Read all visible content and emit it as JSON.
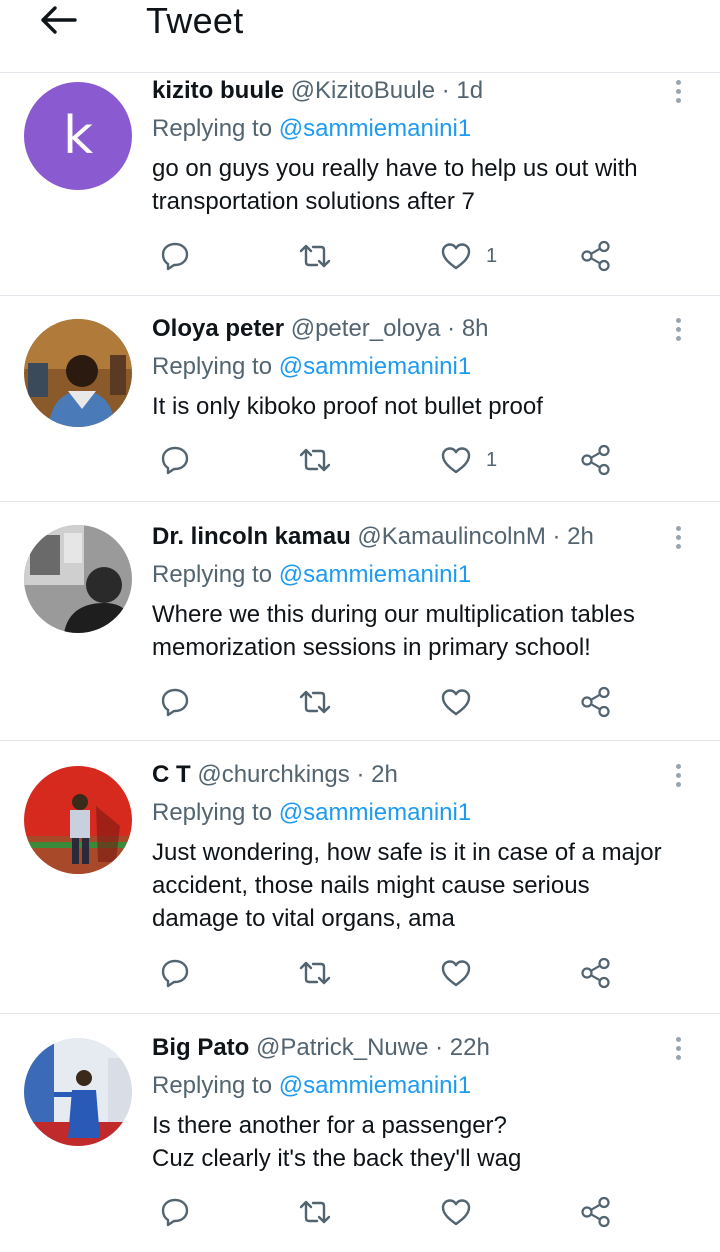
{
  "header": {
    "title": "Tweet",
    "back_icon": "arrow-left-icon"
  },
  "replying_label": "Replying to",
  "tweets": [
    {
      "name": "kizito buule",
      "meta": "@KizitoBuule · 1d",
      "avatar_letter": "k",
      "avatar_color": "#8a5ad0",
      "reply_to": "@sammiemanini1",
      "text": "go on guys you really have to help us out with transportation solutions after 7",
      "likes": "1"
    },
    {
      "name": "Oloya peter",
      "meta": "@peter_oloya · 8h",
      "reply_to": "@sammiemanini1",
      "text": "It is only kiboko proof not bullet proof",
      "likes": "1"
    },
    {
      "name": "Dr. lincoln kamau",
      "meta": "@KamaulincolnM · 2h",
      "reply_to": "@sammiemanini1",
      "text": "Where we this during our multiplication tables memorization sessions in primary school!",
      "likes": ""
    },
    {
      "name": "C T",
      "meta": "@churchkings · 2h",
      "reply_to": "@sammiemanini1",
      "text": "Just wondering, how safe is it in case of a major accident, those nails might cause serious damage to vital organs, ama",
      "likes": ""
    },
    {
      "name": "Big Pato",
      "meta": "@Patrick_Nuwe · 22h",
      "reply_to": "@sammiemanini1",
      "text_lines": [
        "Is there another for a passenger?",
        "Cuz clearly it's the back they'll wag"
      ],
      "likes": ""
    }
  ],
  "colors": {
    "accent": "#1d9bf0",
    "secondary_text": "#536471",
    "divider": "#e1e4e8"
  },
  "icons": [
    "reply-icon",
    "retweet-icon",
    "like-icon",
    "share-icon",
    "more-icon"
  ]
}
